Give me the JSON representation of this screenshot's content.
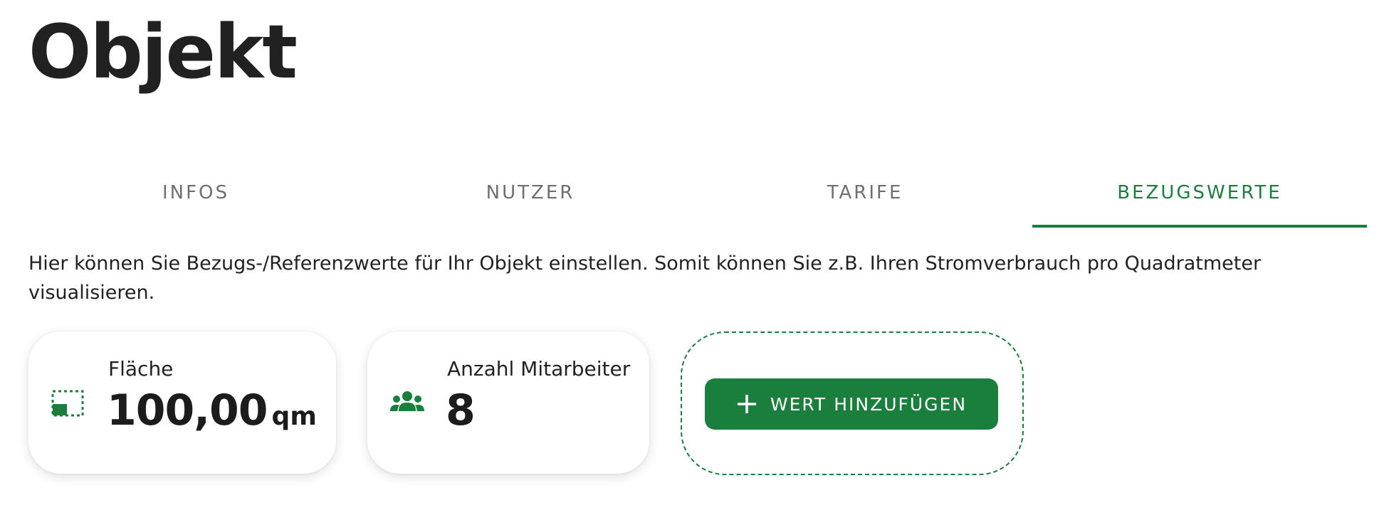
{
  "header": {
    "title": "Objekt"
  },
  "tabs": [
    {
      "label": "INFOS",
      "active": false
    },
    {
      "label": "NUTZER",
      "active": false
    },
    {
      "label": "TARIFE",
      "active": false
    },
    {
      "label": "BEZUGSWERTE",
      "active": true
    }
  ],
  "description": "Hier können Sie Bezugs-/Referenzwerte für Ihr Objekt einstellen. Somit können Sie z.B. Ihren Stromverbrauch pro Quadratmeter visualisieren.",
  "reference_values": [
    {
      "label": "Fläche",
      "value": "100,00",
      "unit": "qm",
      "icon": "area-icon"
    },
    {
      "label": "Anzahl Mitarbeiter",
      "value": "8",
      "unit": "",
      "icon": "people-icon"
    }
  ],
  "add_button": {
    "label": "WERT HINZUFÜGEN",
    "icon": "plus-icon"
  },
  "colors": {
    "accent": "#1a7f3c",
    "tab_inactive": "#6f6f6f",
    "text": "#222222"
  }
}
